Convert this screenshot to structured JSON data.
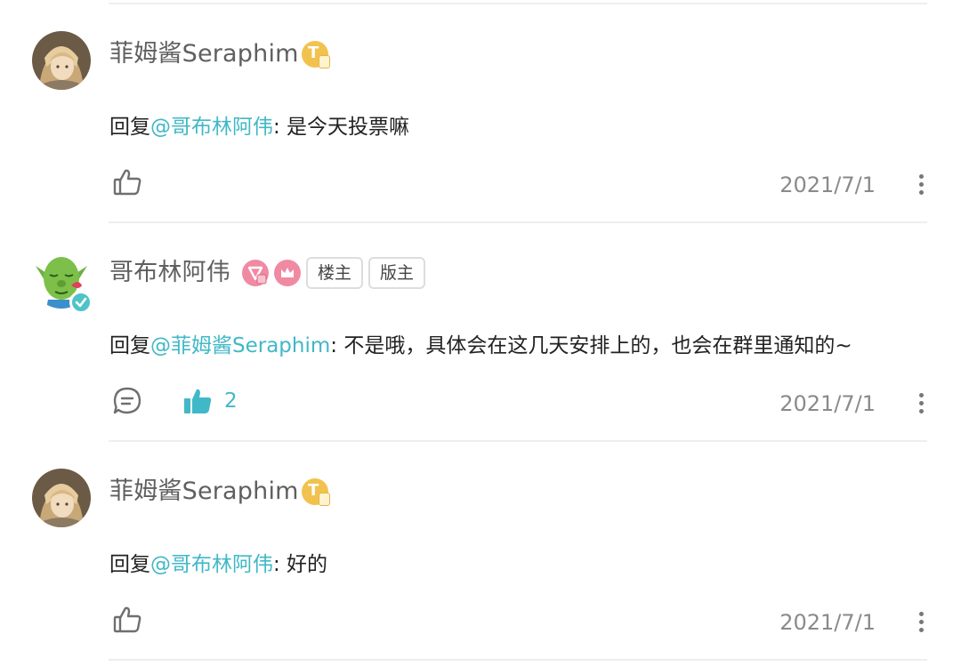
{
  "comments": [
    {
      "username": "菲姆酱Seraphim",
      "reply_prefix": "回复",
      "mention": "@哥布林阿伟",
      "text": ": 是今天投票嘛",
      "date": "2021/7/1",
      "badge_letter": "T",
      "like_count": "",
      "liked": false
    },
    {
      "username": "哥布林阿伟",
      "tags": [
        "楼主",
        "版主"
      ],
      "reply_prefix": "回复",
      "mention": "@菲姆酱Seraphim",
      "text": ": 不是哦，具体会在这几天安排上的，也会在群里通知的~",
      "date": "2021/7/1",
      "like_count": "2",
      "liked": true
    },
    {
      "username": "菲姆酱Seraphim",
      "reply_prefix": "回复",
      "mention": "@哥布林阿伟",
      "text": ": 好的",
      "date": "2021/7/1",
      "badge_letter": "T",
      "like_count": "",
      "liked": false
    }
  ],
  "colors": {
    "mention": "#41b8c7",
    "liked": "#41b8c7",
    "badge_gold": "#f2c24e",
    "badge_pink": "#f08aa3",
    "divider": "#eeeeee"
  },
  "icons": [
    "like-icon",
    "liked-icon",
    "reply-icon",
    "more-icon",
    "verified-icon",
    "level-badge-icon",
    "crown-badge-icon"
  ]
}
